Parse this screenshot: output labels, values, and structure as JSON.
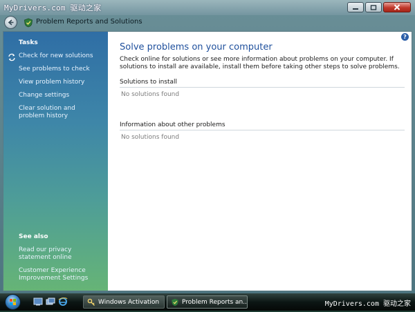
{
  "window": {
    "watermark": "MyDrivers.com 驱动之家",
    "breadcrumb": "Problem Reports and Solutions"
  },
  "sidebar": {
    "tasks_heading": "Tasks",
    "tasks": [
      {
        "label": "Check for new solutions",
        "icon": "refresh-arrows-icon"
      },
      {
        "label": "See problems to check"
      },
      {
        "label": "View problem history"
      },
      {
        "label": "Change settings"
      },
      {
        "label": "Clear solution and problem history"
      }
    ],
    "see_also_heading": "See also",
    "see_also": [
      {
        "label": "Read our privacy statement online"
      },
      {
        "label": "Customer Experience Improvement Settings"
      }
    ]
  },
  "main": {
    "title": "Solve problems on your computer",
    "description": "Check online for solutions or see more information about problems on your computer. If solutions to install are available, install them before taking other steps to solve problems.",
    "sections": [
      {
        "heading": "Solutions to install",
        "empty": "No solutions found"
      },
      {
        "heading": "Information about other problems",
        "empty": "No solutions found"
      }
    ],
    "help_symbol": "?"
  },
  "taskbar": {
    "buttons": [
      {
        "label": "Windows Activation"
      },
      {
        "label": "Problem Reports an..."
      }
    ],
    "tray_watermark": "MyDrivers.com 驱动之家"
  },
  "colors": {
    "title_blue": "#1e4f9c",
    "sidebar_top": "#2f6ea5",
    "sidebar_bottom": "#66b476"
  }
}
